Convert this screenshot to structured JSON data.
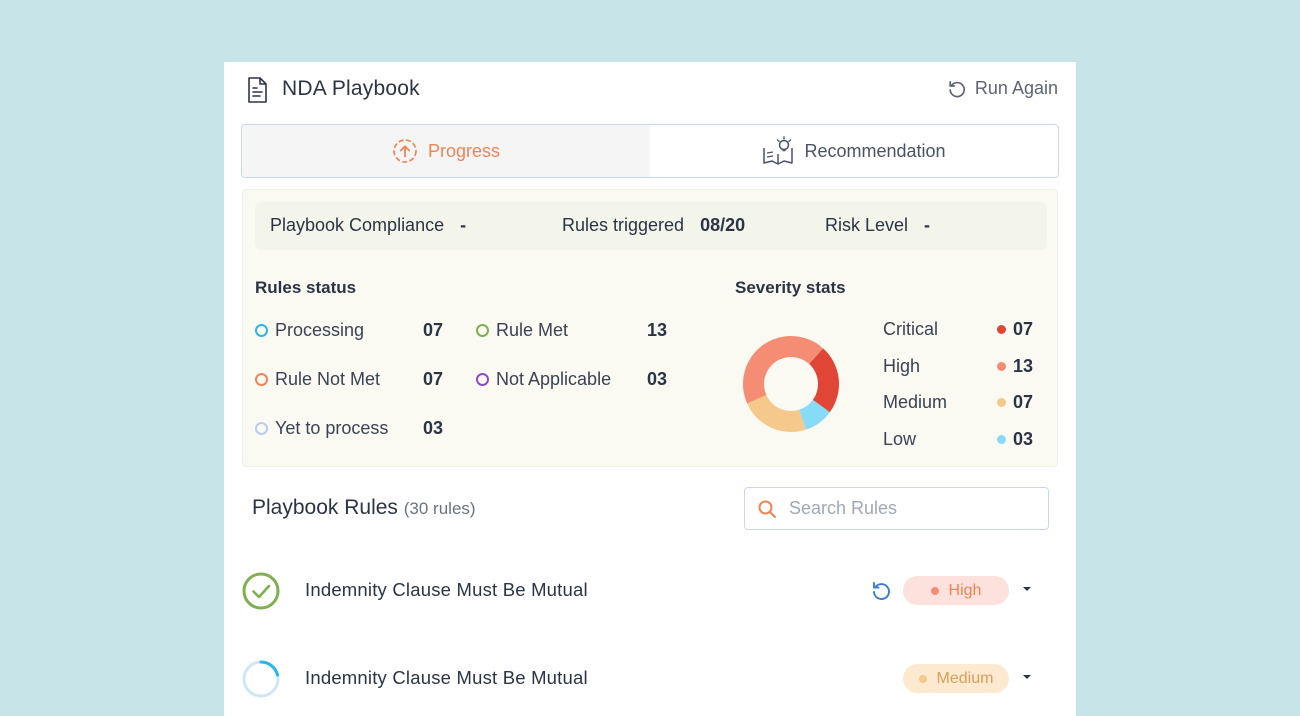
{
  "header": {
    "title": "NDA Playbook",
    "run_again_label": "Run Again"
  },
  "tabs": [
    {
      "label": "Progress",
      "active": true
    },
    {
      "label": "Recommendation",
      "active": false
    }
  ],
  "summary": {
    "compliance_label": "Playbook Compliance",
    "compliance_value": "-",
    "triggered_label": "Rules triggered",
    "triggered_value": "08/20",
    "risk_label": "Risk Level",
    "risk_value": "-"
  },
  "rules_status": {
    "title": "Rules status",
    "items": [
      {
        "label": "Processing",
        "value": "07",
        "color": "#29b6e8"
      },
      {
        "label": "Rule Met",
        "value": "13",
        "color": "#7fb04e"
      },
      {
        "label": "Rule Not Met",
        "value": "07",
        "color": "#f08457"
      },
      {
        "label": "Not Applicable",
        "value": "03",
        "color": "#8e4bbf"
      },
      {
        "label": "Yet to process",
        "value": "03",
        "color": "#b9cdef"
      }
    ]
  },
  "severity_stats": {
    "title": "Severity stats",
    "items": [
      {
        "label": "Critical",
        "value": "07",
        "color": "#e14536"
      },
      {
        "label": "High",
        "value": "13",
        "color": "#f58d74"
      },
      {
        "label": "Medium",
        "value": "07",
        "color": "#f5c98b"
      },
      {
        "label": "Low",
        "value": "03",
        "color": "#86dcf6"
      }
    ]
  },
  "chart_data": {
    "type": "pie",
    "title": "",
    "categories": [
      "Critical",
      "High",
      "Medium",
      "Low"
    ],
    "values": [
      7,
      13,
      7,
      3
    ],
    "colors": [
      "#e14536",
      "#f58d74",
      "#f5c98b",
      "#86dcf6"
    ],
    "donut": true
  },
  "playbook_rules": {
    "title": "Playbook Rules",
    "count_label": "(30 rules)",
    "search_placeholder": "Search Rules",
    "rows": [
      {
        "text": "Indemnity Clause Must Be Mutual",
        "status": "rule-met",
        "severity": "High",
        "badge_bg": "#fde1dd",
        "badge_color": "#f08457",
        "dot_color": "#f58d74",
        "refresh": true
      },
      {
        "text": "Indemnity Clause Must Be Mutual",
        "status": "processing",
        "severity": "Medium",
        "badge_bg": "#fde9cf",
        "badge_color": "#d8a05a",
        "dot_color": "#f5c98b",
        "refresh": false
      }
    ]
  }
}
